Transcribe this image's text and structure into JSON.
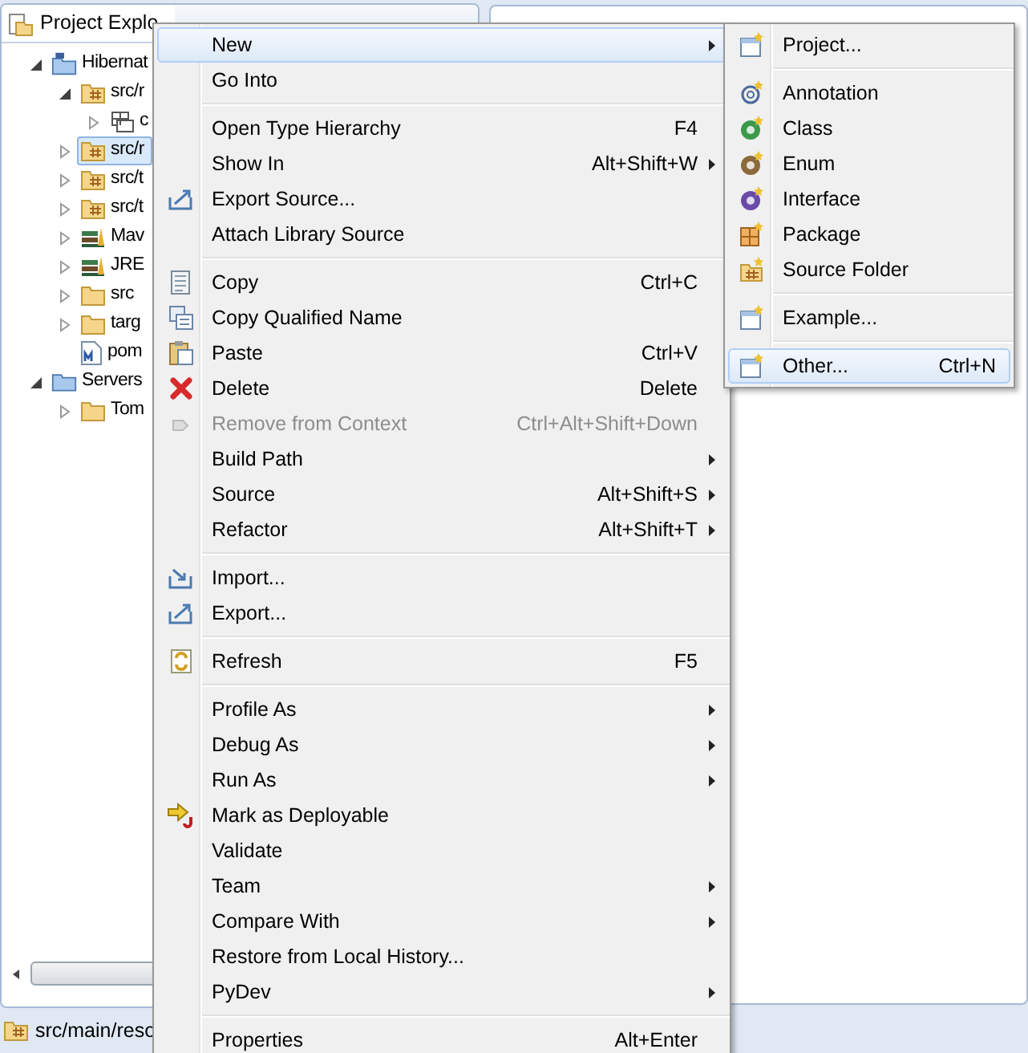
{
  "explorer": {
    "title": "Project Explo",
    "tree": [
      {
        "label": "Hibernat",
        "kind": "project",
        "expanded": true,
        "selected": false,
        "children": [
          {
            "label": "src/r",
            "kind": "source-folder",
            "expanded": true,
            "selected": false,
            "children": [
              {
                "label": "c",
                "kind": "package",
                "expanded": false,
                "selected": false
              }
            ]
          },
          {
            "label": "src/r",
            "kind": "source-folder",
            "expanded": false,
            "selected": true
          },
          {
            "label": "src/t",
            "kind": "source-folder",
            "expanded": false,
            "selected": false
          },
          {
            "label": "src/t",
            "kind": "source-folder",
            "expanded": false,
            "selected": false
          },
          {
            "label": "Mav",
            "kind": "library",
            "expanded": false,
            "selected": false
          },
          {
            "label": "JRE",
            "kind": "library",
            "expanded": false,
            "selected": false
          },
          {
            "label": "src",
            "kind": "folder",
            "expanded": false,
            "selected": false
          },
          {
            "label": "targ",
            "kind": "folder",
            "expanded": false,
            "selected": false
          },
          {
            "label": "pom",
            "kind": "file",
            "selected": false
          }
        ]
      },
      {
        "label": "Servers",
        "kind": "servers",
        "expanded": true,
        "selected": false,
        "children": [
          {
            "label": "Tom",
            "kind": "folder",
            "expanded": false,
            "selected": false
          }
        ]
      }
    ]
  },
  "status_bar": {
    "text": "src/main/reso"
  },
  "context_menu": [
    {
      "kind": "item",
      "label": "New",
      "submenu": true,
      "selected": true,
      "disabled": false
    },
    {
      "kind": "item",
      "label": "Go Into",
      "submenu": false,
      "selected": false,
      "disabled": false
    },
    {
      "kind": "separator"
    },
    {
      "kind": "item",
      "label": "Open Type Hierarchy",
      "shortcut": "F4",
      "submenu": false,
      "selected": false,
      "disabled": false
    },
    {
      "kind": "item",
      "label": "Show In",
      "shortcut": "Alt+Shift+W",
      "submenu": true,
      "selected": false,
      "disabled": false
    },
    {
      "kind": "item",
      "label": "Export Source...",
      "submenu": false,
      "selected": false,
      "disabled": false
    },
    {
      "kind": "item",
      "label": "Attach Library Source",
      "submenu": false,
      "selected": false,
      "disabled": false
    },
    {
      "kind": "separator"
    },
    {
      "kind": "item",
      "label": "Copy",
      "shortcut": "Ctrl+C",
      "submenu": false,
      "selected": false,
      "disabled": false
    },
    {
      "kind": "item",
      "label": "Copy Qualified Name",
      "submenu": false,
      "selected": false,
      "disabled": false
    },
    {
      "kind": "item",
      "label": "Paste",
      "shortcut": "Ctrl+V",
      "submenu": false,
      "selected": false,
      "disabled": false
    },
    {
      "kind": "item",
      "label": "Delete",
      "shortcut": "Delete",
      "submenu": false,
      "selected": false,
      "disabled": false
    },
    {
      "kind": "item",
      "label": "Remove from Context",
      "shortcut": "Ctrl+Alt+Shift+Down",
      "submenu": false,
      "selected": false,
      "disabled": true
    },
    {
      "kind": "item",
      "label": "Build Path",
      "submenu": true,
      "selected": false,
      "disabled": false
    },
    {
      "kind": "item",
      "label": "Source",
      "shortcut": "Alt+Shift+S",
      "submenu": true,
      "selected": false,
      "disabled": false
    },
    {
      "kind": "item",
      "label": "Refactor",
      "shortcut": "Alt+Shift+T",
      "submenu": true,
      "selected": false,
      "disabled": false
    },
    {
      "kind": "separator"
    },
    {
      "kind": "item",
      "label": "Import...",
      "submenu": false,
      "selected": false,
      "disabled": false
    },
    {
      "kind": "item",
      "label": "Export...",
      "submenu": false,
      "selected": false,
      "disabled": false
    },
    {
      "kind": "separator"
    },
    {
      "kind": "item",
      "label": "Refresh",
      "shortcut": "F5",
      "submenu": false,
      "selected": false,
      "disabled": false
    },
    {
      "kind": "separator"
    },
    {
      "kind": "item",
      "label": "Profile As",
      "submenu": true,
      "selected": false,
      "disabled": false
    },
    {
      "kind": "item",
      "label": "Debug As",
      "submenu": true,
      "selected": false,
      "disabled": false
    },
    {
      "kind": "item",
      "label": "Run As",
      "submenu": true,
      "selected": false,
      "disabled": false
    },
    {
      "kind": "item",
      "label": "Mark as Deployable",
      "submenu": false,
      "selected": false,
      "disabled": false
    },
    {
      "kind": "item",
      "label": "Validate",
      "submenu": false,
      "selected": false,
      "disabled": false
    },
    {
      "kind": "item",
      "label": "Team",
      "submenu": true,
      "selected": false,
      "disabled": false
    },
    {
      "kind": "item",
      "label": "Compare With",
      "submenu": true,
      "selected": false,
      "disabled": false
    },
    {
      "kind": "item",
      "label": "Restore from Local History...",
      "submenu": false,
      "selected": false,
      "disabled": false
    },
    {
      "kind": "item",
      "label": "PyDev",
      "submenu": true,
      "selected": false,
      "disabled": false
    },
    {
      "kind": "separator"
    },
    {
      "kind": "item",
      "label": "Properties",
      "shortcut": "Alt+Enter",
      "submenu": false,
      "selected": false,
      "disabled": false
    }
  ],
  "new_submenu": [
    {
      "kind": "item",
      "label": "Project...",
      "selected": false
    },
    {
      "kind": "separator"
    },
    {
      "kind": "item",
      "label": "Annotation",
      "selected": false
    },
    {
      "kind": "item",
      "label": "Class",
      "selected": false
    },
    {
      "kind": "item",
      "label": "Enum",
      "selected": false
    },
    {
      "kind": "item",
      "label": "Interface",
      "selected": false
    },
    {
      "kind": "item",
      "label": "Package",
      "selected": false
    },
    {
      "kind": "item",
      "label": "Source Folder",
      "selected": false
    },
    {
      "kind": "separator"
    },
    {
      "kind": "item",
      "label": "Example...",
      "selected": false
    },
    {
      "kind": "separator"
    },
    {
      "kind": "item",
      "label": "Other...",
      "shortcut": "Ctrl+N",
      "selected": true
    }
  ]
}
